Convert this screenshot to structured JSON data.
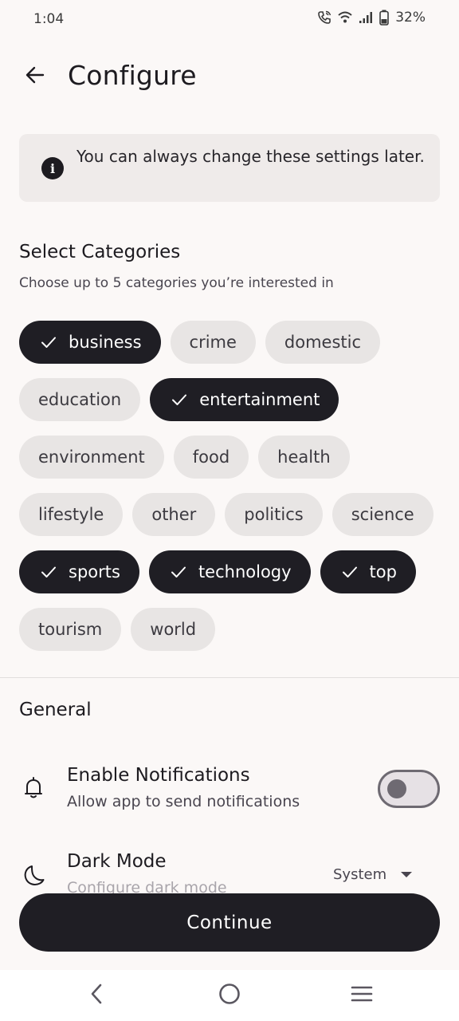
{
  "status_bar": {
    "time": "1:04",
    "battery": "32%",
    "icons": [
      "call-wifi-icon",
      "wifi-icon",
      "signal-icon",
      "battery-icon"
    ]
  },
  "header": {
    "back_icon": "arrow-left-icon",
    "title": "Configure"
  },
  "info": {
    "icon": "info-icon",
    "text": "You can always change these settings later."
  },
  "categories": {
    "title": "Select Categories",
    "subtitle": "Choose up to 5 categories you’re interested in",
    "rows": [
      [
        {
          "label": "business",
          "selected": true
        },
        {
          "label": "crime",
          "selected": false
        },
        {
          "label": "domestic",
          "selected": false
        }
      ],
      [
        {
          "label": "education",
          "selected": false
        },
        {
          "label": "entertainment",
          "selected": true
        }
      ],
      [
        {
          "label": "environment",
          "selected": false
        },
        {
          "label": "food",
          "selected": false
        },
        {
          "label": "health",
          "selected": false
        }
      ],
      [
        {
          "label": "lifestyle",
          "selected": false
        },
        {
          "label": "other",
          "selected": false
        },
        {
          "label": "politics",
          "selected": false
        },
        {
          "label": "science",
          "selected": false
        }
      ],
      [
        {
          "label": "sports",
          "selected": true
        },
        {
          "label": "technology",
          "selected": true
        },
        {
          "label": "top",
          "selected": true
        }
      ],
      [
        {
          "label": "tourism",
          "selected": false
        },
        {
          "label": "world",
          "selected": false
        }
      ]
    ]
  },
  "general": {
    "title": "General",
    "notifications": {
      "icon": "bell-icon",
      "title": "Enable Notifications",
      "subtitle": "Allow app to send notifications",
      "enabled": false
    },
    "dark_mode": {
      "icon": "moon-icon",
      "title": "Dark Mode",
      "subtitle": "Configure dark mode",
      "value": "System"
    }
  },
  "continue_label": "Continue",
  "nav": {
    "back_icon": "nav-back-icon",
    "home_icon": "nav-home-icon",
    "recents_icon": "nav-recents-icon"
  },
  "colors": {
    "background": "#fbf8f7",
    "selected_chip": "#1f1e24",
    "chip": "#e8e5e4"
  }
}
